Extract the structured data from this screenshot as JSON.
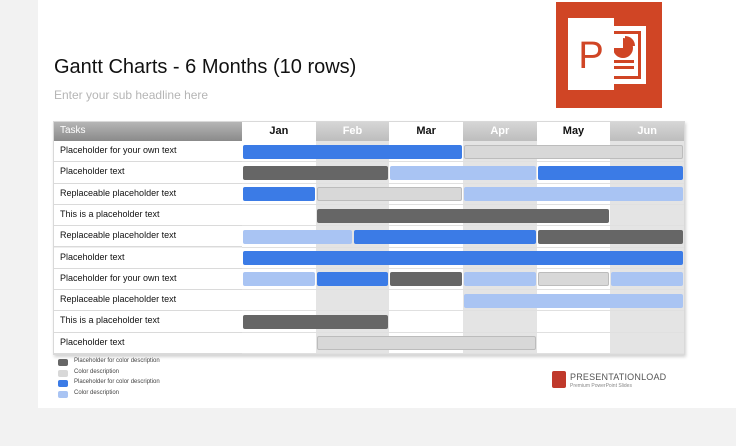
{
  "title": "Gantt Charts - 6 Months (10 rows)",
  "subtitle": "Enter your sub headline here",
  "gantt": {
    "tasks_header": "Tasks",
    "months": [
      "Jan",
      "Feb",
      "Mar",
      "Apr",
      "May",
      "Jun"
    ],
    "tasks": [
      "Placeholder for your own text",
      "Placeholder text",
      "Replaceable placeholder text",
      "This is a placeholder text",
      "Replaceable placeholder text",
      "Placeholder text",
      "Placeholder for your own text",
      "Replaceable placeholder text",
      "This is a placeholder text",
      "Placeholder text"
    ],
    "bars": [
      {
        "row": 0,
        "start": 0,
        "end": 3,
        "color": "blue"
      },
      {
        "row": 0,
        "start": 3,
        "end": 6,
        "color": "gray"
      },
      {
        "row": 1,
        "start": 0,
        "end": 2,
        "color": "dark"
      },
      {
        "row": 1,
        "start": 2,
        "end": 4,
        "color": "light"
      },
      {
        "row": 1,
        "start": 4,
        "end": 6,
        "color": "blue"
      },
      {
        "row": 2,
        "start": 0,
        "end": 1,
        "color": "blue"
      },
      {
        "row": 2,
        "start": 1,
        "end": 3,
        "color": "gray"
      },
      {
        "row": 2,
        "start": 3,
        "end": 6,
        "color": "light"
      },
      {
        "row": 3,
        "start": 1,
        "end": 5,
        "color": "dark"
      },
      {
        "row": 4,
        "start": 0,
        "end": 1.5,
        "color": "light"
      },
      {
        "row": 4,
        "start": 1.5,
        "end": 4,
        "color": "blue"
      },
      {
        "row": 4,
        "start": 4,
        "end": 6,
        "color": "dark"
      },
      {
        "row": 5,
        "start": 0,
        "end": 6,
        "color": "blue"
      },
      {
        "row": 6,
        "start": 0,
        "end": 1,
        "color": "light"
      },
      {
        "row": 6,
        "start": 1,
        "end": 2,
        "color": "blue"
      },
      {
        "row": 6,
        "start": 2,
        "end": 3,
        "color": "dark"
      },
      {
        "row": 6,
        "start": 3,
        "end": 4,
        "color": "light"
      },
      {
        "row": 6,
        "start": 4,
        "end": 5,
        "color": "gray"
      },
      {
        "row": 6,
        "start": 5,
        "end": 6,
        "color": "light"
      },
      {
        "row": 7,
        "start": 3,
        "end": 6,
        "color": "light"
      },
      {
        "row": 8,
        "start": 0,
        "end": 2,
        "color": "dark"
      },
      {
        "row": 9,
        "start": 1,
        "end": 4,
        "color": "gray"
      }
    ]
  },
  "colors": {
    "dark": "#666666",
    "gray": "#d8d8d8",
    "blue": "#3b7be6",
    "light": "#a9c4f3",
    "logo": "#d04525"
  },
  "legend": [
    {
      "color": "dark",
      "label": "Placeholder for color description"
    },
    {
      "color": "gray",
      "label": "Color description"
    },
    {
      "color": "blue",
      "label": "Placeholder for color description"
    },
    {
      "color": "light",
      "label": "Color description"
    }
  ],
  "brand": {
    "name": "PRESENTATIONLOAD",
    "tagline": "Premium PowerPoint Slides",
    "logo_letter": "P"
  },
  "icons": [
    "powerpoint-logo-icon",
    "presentationload-logo-icon"
  ]
}
